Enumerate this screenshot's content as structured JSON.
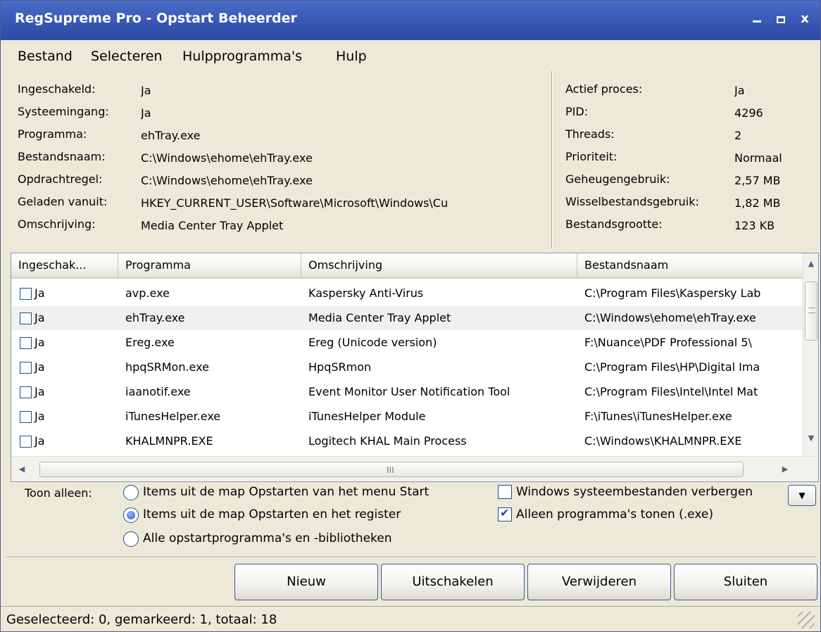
{
  "window": {
    "title": "RegSupreme Pro - Opstart Beheerder",
    "minimize_icon": "minimize-icon",
    "maximize_icon": "maximize-icon",
    "close_glyph": "x"
  },
  "menu": [
    "Bestand",
    "Selecteren",
    "Hulpprogramma's",
    "Hulp"
  ],
  "details": [
    {
      "label": "Ingeschakeld:",
      "value": "Ja"
    },
    {
      "label": "Systeemingang:",
      "value": "Ja"
    },
    {
      "label": "Programma:",
      "value": "ehTray.exe"
    },
    {
      "label": "Bestandsnaam:",
      "value": "C:\\Windows\\ehome\\ehTray.exe"
    },
    {
      "label": "Opdrachtregel:",
      "value": "C:\\Windows\\ehome\\ehTray.exe"
    },
    {
      "label": "Geladen vanuit:",
      "value": "HKEY_CURRENT_USER\\Software\\Microsoft\\Windows\\Cu"
    },
    {
      "label": "Omschrijving:",
      "value": "Media Center Tray Applet"
    }
  ],
  "process": [
    {
      "label": "Actief proces:",
      "value": "Ja"
    },
    {
      "label": "PID:",
      "value": "4296"
    },
    {
      "label": "Threads:",
      "value": "2"
    },
    {
      "label": "Prioriteit:",
      "value": "Normaal"
    },
    {
      "label": "Geheugengebruik:",
      "value": "2,57 MB"
    },
    {
      "label": "Wisselbestandsgebruik:",
      "value": "1,82 MB"
    },
    {
      "label": "Bestandsgrootte:",
      "value": "123 KB"
    }
  ],
  "list": {
    "columns": [
      "Ingeschak...",
      "Programma",
      "Omschrijving",
      "Bestandsnaam"
    ],
    "rows": [
      {
        "enabled": "Ja",
        "program": "avp.exe",
        "description": "Kaspersky Anti-Virus",
        "file": "C:\\Program Files\\Kaspersky Lab",
        "checked": false
      },
      {
        "enabled": "Ja",
        "program": "ehTray.exe",
        "description": "Media Center Tray Applet",
        "file": "C:\\Windows\\ehome\\ehTray.exe",
        "checked": false
      },
      {
        "enabled": "Ja",
        "program": "Ereg.exe",
        "description": "Ereg (Unicode version)",
        "file": "F:\\Nuance\\PDF Professional 5\\",
        "checked": false
      },
      {
        "enabled": "Ja",
        "program": "hpqSRMon.exe",
        "description": "HpqSRmon",
        "file": "C:\\Program Files\\HP\\Digital Ima",
        "checked": false
      },
      {
        "enabled": "Ja",
        "program": "iaanotif.exe",
        "description": "Event Monitor User Notification Tool",
        "file": "C:\\Program Files\\Intel\\Intel Mat",
        "checked": false
      },
      {
        "enabled": "Ja",
        "program": "iTunesHelper.exe",
        "description": "iTunesHelper Module",
        "file": "F:\\iTunes\\iTunesHelper.exe",
        "checked": false
      },
      {
        "enabled": "Ja",
        "program": "KHALMNPR.EXE",
        "description": "Logitech KHAL Main Process",
        "file": "C:\\Windows\\KHALMNPR.EXE",
        "checked": false
      }
    ],
    "hscroll_grip": "III"
  },
  "filter": {
    "label": "Toon alleen:",
    "radios": [
      {
        "label": "Items uit de map Opstarten van het menu Start",
        "selected": false
      },
      {
        "label": "Items uit de map Opstarten en het register",
        "selected": true
      },
      {
        "label": "Alle opstartprogramma's en -bibliotheken",
        "selected": false
      }
    ],
    "checkboxes": [
      {
        "label": "Windows systeembestanden verbergen",
        "checked": false
      },
      {
        "label": "Alleen programma's tonen (.exe)",
        "checked": true
      }
    ]
  },
  "buttons": [
    "Nieuw",
    "Uitschakelen",
    "Verwijderen",
    "Sluiten"
  ],
  "status": "Geselecteerd: 0, gemarkeerd: 1, totaal: 18"
}
